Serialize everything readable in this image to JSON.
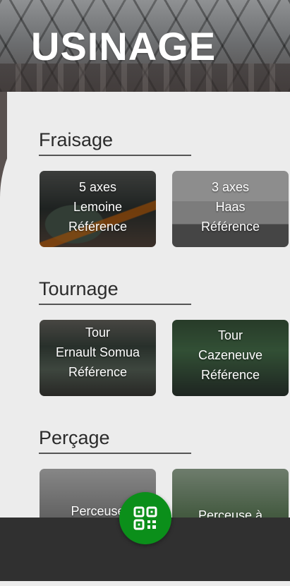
{
  "header": {
    "title": "USINAGE"
  },
  "sections": [
    {
      "title": "Fraisage",
      "cards": [
        {
          "lines": [
            "5 axes",
            "Lemoine",
            "Référence"
          ]
        },
        {
          "lines": [
            "3 axes",
            "Haas",
            "Référence"
          ]
        }
      ]
    },
    {
      "title": "Tournage",
      "cards": [
        {
          "lines": [
            "Tour",
            "Ernault Somua",
            "Référence"
          ]
        },
        {
          "lines": [
            "Tour",
            "Cazeneuve",
            "Référence"
          ]
        }
      ]
    },
    {
      "title": "Perçage",
      "cards": [
        {
          "lines": [
            "Perceuse",
            "",
            ""
          ]
        },
        {
          "lines": [
            "Perceuse à",
            "",
            ""
          ]
        }
      ]
    }
  ],
  "fab": {
    "icon": "qr-code-icon"
  },
  "colors": {
    "accent": "#0b8f1a",
    "bottom_bar": "#303030",
    "sheet": "#ececec"
  }
}
